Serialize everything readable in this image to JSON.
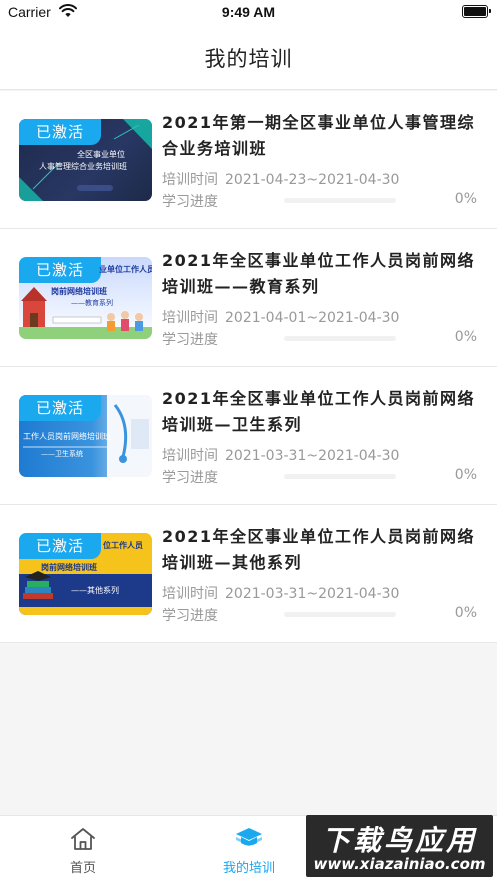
{
  "status_bar": {
    "carrier": "Carrier",
    "time": "9:49 AM"
  },
  "nav": {
    "title": "我的培训"
  },
  "courses": [
    {
      "badge": "已激活",
      "thumb_lines": [
        "全区事业单位",
        "人事管理综合业务培训班"
      ],
      "title": "2021年第一期全区事业单位人事管理综合业务培训班",
      "dates_label": "培训时间",
      "dates": "2021-04-23~2021-04-30",
      "progress_label": "学习进度",
      "progress_value": "0%",
      "progress": 0
    },
    {
      "badge": "已激活",
      "thumb_lines": [
        "业单位工作人员",
        "岗前网络培训班",
        "——教育系列"
      ],
      "title": "2021年全区事业单位工作人员岗前网络培训班——教育系列",
      "dates_label": "培训时间",
      "dates": "2021-04-01~2021-04-30",
      "progress_label": "学习进度",
      "progress_value": "0%",
      "progress": 0
    },
    {
      "badge": "已激活",
      "thumb_lines": [
        "工作人员岗前网络培训班",
        "——卫生系统"
      ],
      "title": "2021年全区事业单位工作人员岗前网络培训班—卫生系列",
      "dates_label": "培训时间",
      "dates": "2021-03-31~2021-04-30",
      "progress_label": "学习进度",
      "progress_value": "0%",
      "progress": 0
    },
    {
      "badge": "已激活",
      "thumb_lines": [
        "位工作人员",
        "岗前网络培训班",
        "——其他系列"
      ],
      "title": "2021年全区事业单位工作人员岗前网络培训班—其他系列",
      "dates_label": "培训时间",
      "dates": "2021-03-31~2021-04-30",
      "progress_label": "学习进度",
      "progress_value": "0%",
      "progress": 0
    }
  ],
  "tabbar": {
    "tabs": [
      {
        "label": "首页",
        "icon": "home-icon",
        "active": false
      },
      {
        "label": "我的培训",
        "icon": "graduation-cap-icon",
        "active": true
      }
    ]
  },
  "watermark": {
    "big": "下载鸟应用",
    "small": "www.xiazainiao.com"
  },
  "colors": {
    "accent": "#1aa8ee",
    "text": "#222222",
    "muted": "#999999",
    "background": "#f5f5f5"
  }
}
